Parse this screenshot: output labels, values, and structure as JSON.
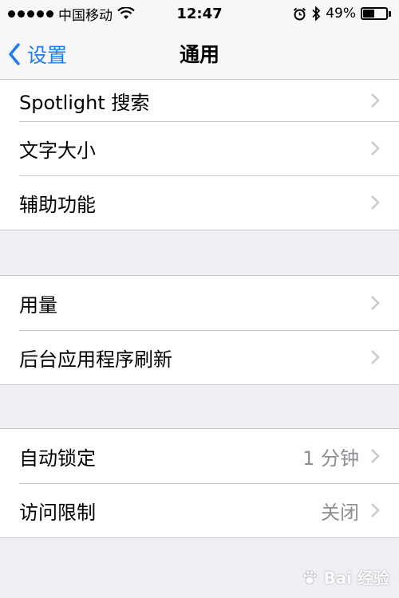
{
  "status_bar": {
    "carrier": "中国移动",
    "time": "12:47",
    "battery_percent_label": "49%",
    "battery_level": 0.49,
    "icons": [
      "signal-dots-icon",
      "wifi-icon",
      "alarm-icon",
      "bluetooth-icon",
      "battery-icon"
    ]
  },
  "nav": {
    "back_label": "设置",
    "title": "通用"
  },
  "groups": [
    {
      "rows": [
        {
          "label": "Spotlight 搜索",
          "value": ""
        },
        {
          "label": "文字大小",
          "value": ""
        },
        {
          "label": "辅助功能",
          "value": ""
        }
      ]
    },
    {
      "rows": [
        {
          "label": "用量",
          "value": ""
        },
        {
          "label": "后台应用程序刷新",
          "value": ""
        }
      ]
    },
    {
      "rows": [
        {
          "label": "自动锁定",
          "value": "1 分钟"
        },
        {
          "label": "访问限制",
          "value": "关闭"
        }
      ]
    }
  ],
  "watermark": {
    "text": "Bai 经验"
  },
  "colors": {
    "accent": "#1a7cf5",
    "background": "#efeff4",
    "separator": "#c8c7cc",
    "secondary_text": "#8e8e93"
  }
}
